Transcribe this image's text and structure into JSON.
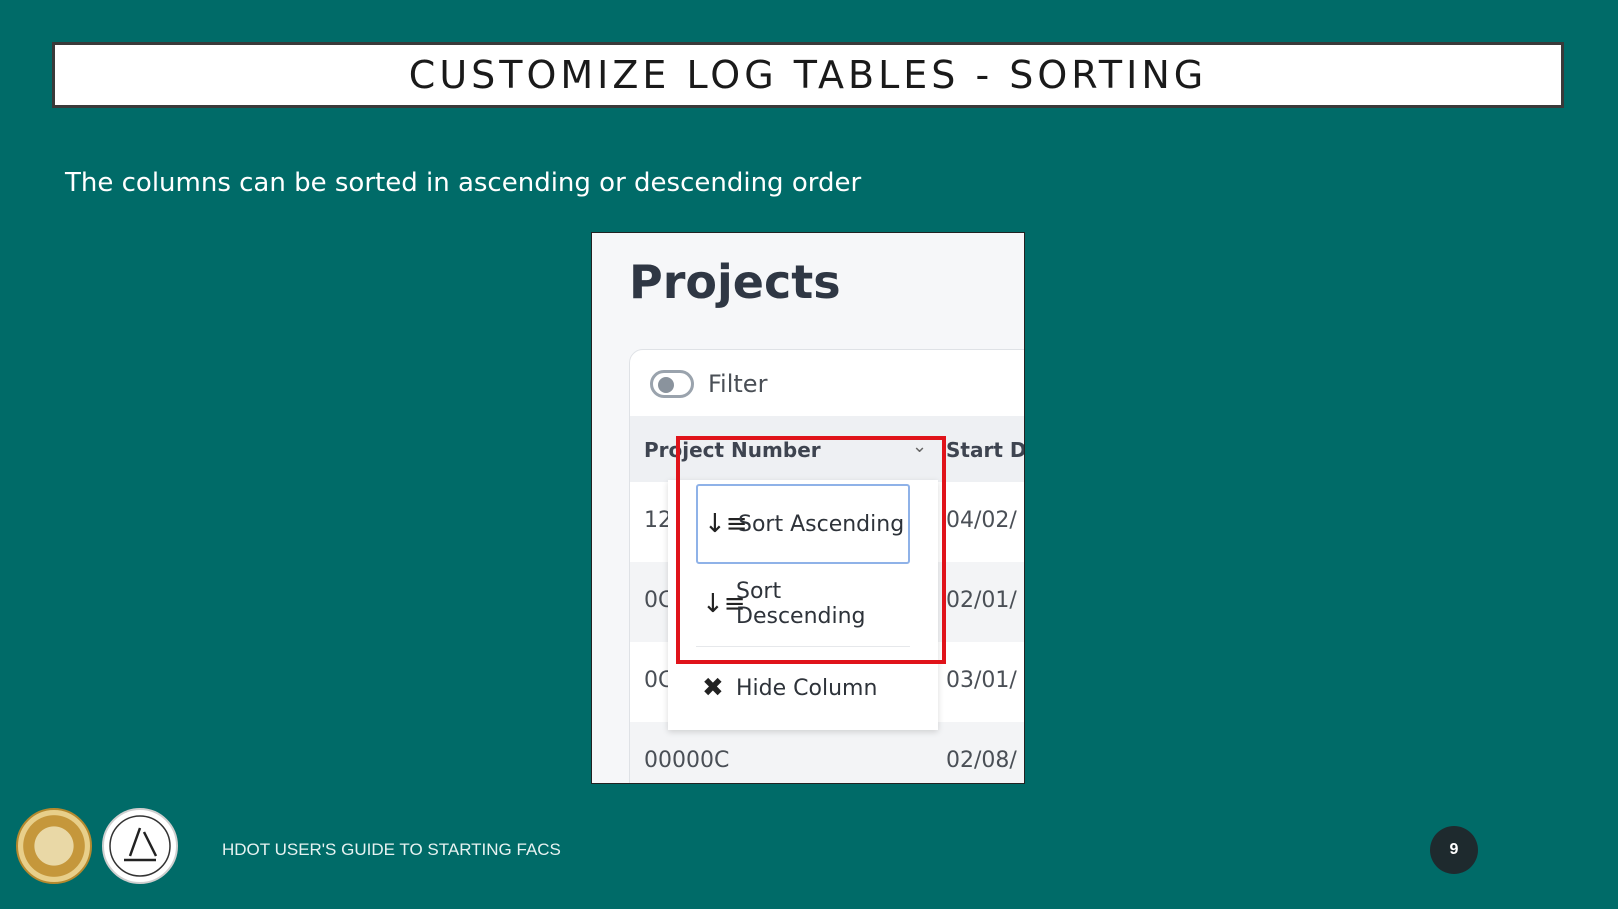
{
  "slide": {
    "title": "CUSTOMIZE LOG TABLES - SORTING",
    "subtitle": "The columns can be sorted in ascending or descending order",
    "footer": "HDOT USER'S GUIDE TO STARTING FACS",
    "page_number": "9"
  },
  "screenshot": {
    "title": "Projects",
    "filter_label": "Filter",
    "columns": [
      "Project Number",
      "Start D"
    ],
    "rows": [
      {
        "project": "12",
        "start": "04/02/"
      },
      {
        "project": "0C",
        "start": "02/01/"
      },
      {
        "project": "0C",
        "start": "03/01/"
      },
      {
        "project": "00000C",
        "start": "02/08/"
      }
    ],
    "menu": {
      "sort_ascending": "Sort Ascending",
      "sort_descending": "Sort Descending",
      "hide_column": "Hide Column",
      "icons": {
        "sort_ascending": "sort-ascending-icon",
        "sort_descending": "sort-descending-icon",
        "hide_column": "close-icon"
      }
    }
  },
  "colors": {
    "background": "#006b68",
    "highlight": "#e0131a",
    "focus": "#8fb2e8"
  }
}
